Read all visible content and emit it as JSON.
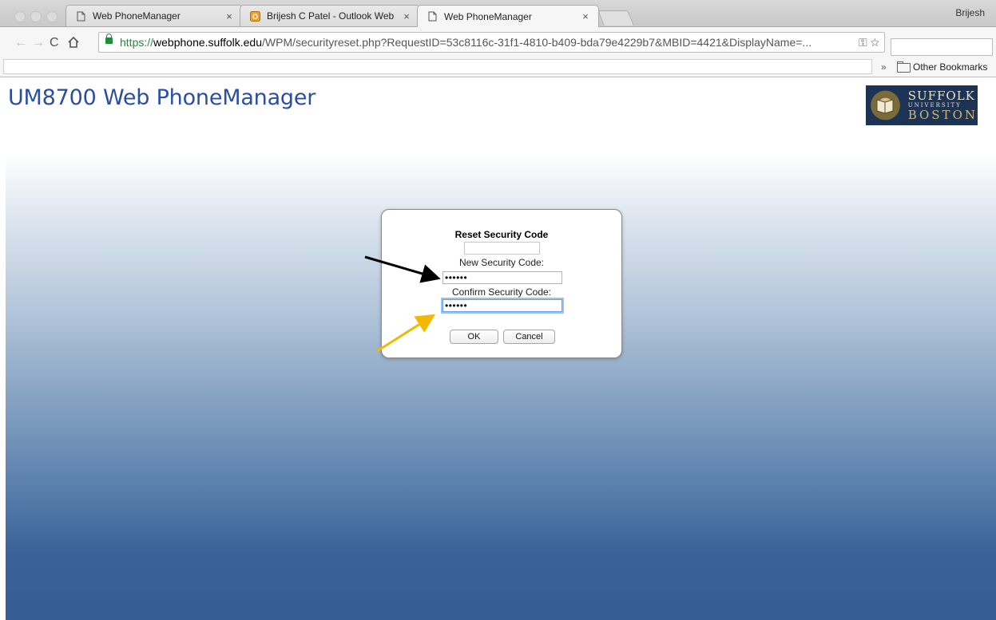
{
  "browser": {
    "profile_name": "Brijesh",
    "tabs": [
      {
        "title": "Web PhoneManager",
        "favicon": "page-icon",
        "active": false
      },
      {
        "title": "Brijesh C Patel - Outlook Web",
        "favicon": "outlook-icon",
        "active": false
      },
      {
        "title": "Web PhoneManager",
        "favicon": "page-icon",
        "active": true
      }
    ],
    "close_glyph": "×",
    "url": {
      "scheme": "https://",
      "host": "webphone.suffolk.edu",
      "path": "/WPM/securityreset.php?RequestID=53c8116c-31f1-4810-b409-bda79e4229b7&MBID=4421&DisplayName=..."
    },
    "bookmarks": {
      "more": "»",
      "other_bookmarks": "Other Bookmarks"
    }
  },
  "page": {
    "app_title": "UM8700 Web PhoneManager",
    "logo": {
      "line1": "SUFFOLK",
      "line2": "UNIVERSITY",
      "line3": "BOSTON"
    }
  },
  "dialog": {
    "title": "Reset Security Code",
    "new_code_label": "New Security Code:",
    "new_code_value": "••••••",
    "confirm_code_label": "Confirm Security Code:",
    "confirm_code_value": "••••••",
    "ok_label": "OK",
    "cancel_label": "Cancel"
  },
  "annotations": {
    "arrow_colors": {
      "black": "#000000",
      "yellow": "#f5b800"
    }
  }
}
